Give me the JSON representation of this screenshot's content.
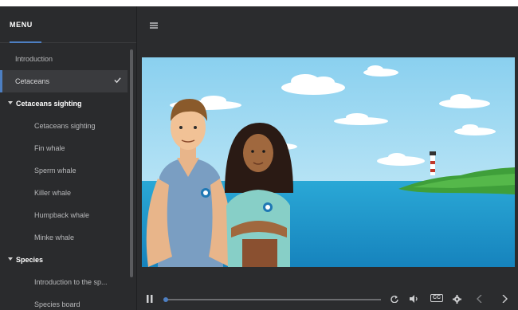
{
  "sidebar": {
    "title": "MENU",
    "items": [
      {
        "label": "Introduction",
        "level": 1,
        "active": false
      },
      {
        "label": "Cetaceans",
        "level": 1,
        "active": true
      },
      {
        "label": "Cetaceans sighting",
        "section": true
      },
      {
        "label": "Cetaceans sighting",
        "level": 2
      },
      {
        "label": "Fin whale",
        "level": 2
      },
      {
        "label": "Sperm whale",
        "level": 2
      },
      {
        "label": "Killer whale",
        "level": 2
      },
      {
        "label": "Humpback whale",
        "level": 2
      },
      {
        "label": "Minke whale",
        "level": 2
      },
      {
        "label": "Species",
        "section": true
      },
      {
        "label": "Introduction to the sp...",
        "level": 2
      },
      {
        "label": "Species board",
        "level": 2
      }
    ]
  },
  "toolbar": {
    "menu_icon": "hamburger-icon"
  },
  "player": {
    "progress": 0.02,
    "icons": [
      "pause-icon",
      "replay-icon",
      "volume-icon",
      "cc-icon",
      "settings-icon",
      "prev-icon",
      "next-icon"
    ],
    "cc_label": "CC"
  },
  "colors": {
    "accent": "#4d7fc2",
    "sidebar_bg": "#2a2b2d",
    "sky": "#8fd2f0",
    "sea": "#1f96c8"
  }
}
